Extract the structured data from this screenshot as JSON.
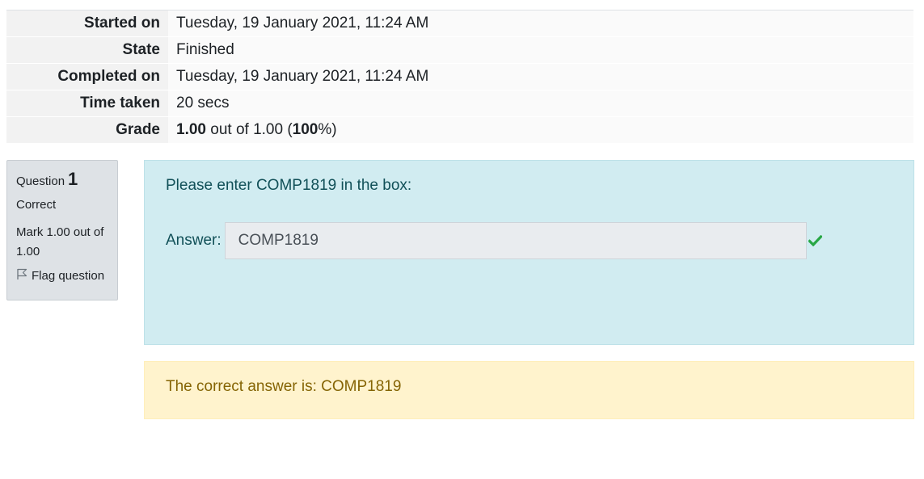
{
  "summary": {
    "rows": [
      {
        "label": "Started on",
        "value": "Tuesday, 19 January 2021, 11:24 AM"
      },
      {
        "label": "State",
        "value": "Finished"
      },
      {
        "label": "Completed on",
        "value": "Tuesday, 19 January 2021, 11:24 AM"
      },
      {
        "label": "Time taken",
        "value": "20 secs"
      }
    ],
    "grade": {
      "label": "Grade",
      "score": "1.00",
      "mid": " out of 1.00 (",
      "percent": "100",
      "end": "%)"
    }
  },
  "question": {
    "number_label": "Question",
    "number": "1",
    "state": "Correct",
    "mark": "Mark 1.00 out of 1.00",
    "flag_label": "Flag question",
    "flag_icon": "flag-icon",
    "text": "Please enter COMP1819 in the box:",
    "answer_label": "Answer:",
    "answer_value": "COMP1819",
    "correct_icon": "check-icon",
    "correct_color": "#28a745"
  },
  "feedback": {
    "text": "The correct answer is: COMP1819"
  }
}
